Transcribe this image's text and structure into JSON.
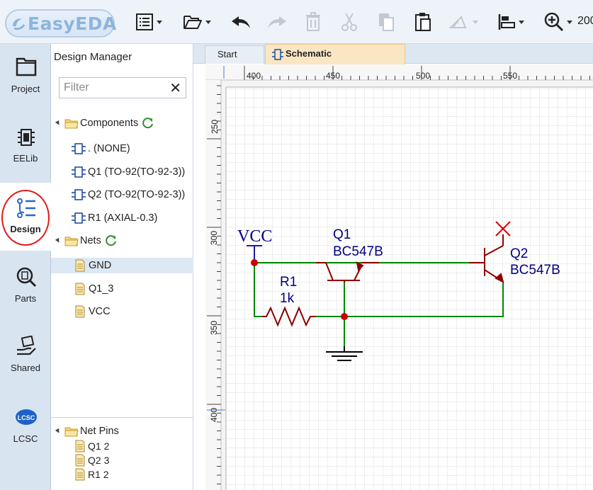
{
  "app": {
    "brand": "EasyEDA"
  },
  "toolbar": {
    "zoom_text": "200"
  },
  "nav": [
    {
      "label": "Project",
      "icon": "folder-icon"
    },
    {
      "label": "EELib",
      "icon": "chip-icon"
    },
    {
      "label": "Design",
      "icon": "design-tree-icon"
    },
    {
      "label": "Parts",
      "icon": "parts-search-icon"
    },
    {
      "label": "Shared",
      "icon": "shared-hand-icon"
    },
    {
      "label": "LCSC",
      "icon": "lcsc-logo-icon"
    }
  ],
  "design_manager": {
    "title": "Design Manager",
    "filter_placeholder": "Filter",
    "components_label": "Components",
    "components": [
      ". (NONE)",
      "Q1 (TO-92(TO-92-3))",
      "Q2 (TO-92(TO-92-3))",
      "R1 (AXIAL-0.3)"
    ],
    "nets_label": "Nets",
    "nets": [
      "GND",
      "Q1_3",
      "VCC"
    ],
    "selected_net": "GND",
    "net_pins_label": "Net Pins",
    "net_pins": [
      "Q1 2",
      "Q2 3",
      "R1 2"
    ]
  },
  "tabs": [
    {
      "label": "Start"
    },
    {
      "label": "Schematic"
    }
  ],
  "ruler": {
    "top_ticks": [
      "400",
      "450",
      "500",
      "550"
    ],
    "left_ticks": [
      "250",
      "300",
      "350",
      "400"
    ]
  },
  "schematic": {
    "vcc_label": "VCC",
    "q1_ref": "Q1",
    "q1_value": "BC547B",
    "q2_ref": "Q2",
    "q2_value": "BC547B",
    "r1_ref": "R1",
    "r1_value": "1k",
    "colors": {
      "wire": "#008800",
      "part": "#8b0000",
      "text": "#000080",
      "grid": "#dcdcdc",
      "junction": "#cc0000",
      "noconnect": "#e00000"
    }
  }
}
